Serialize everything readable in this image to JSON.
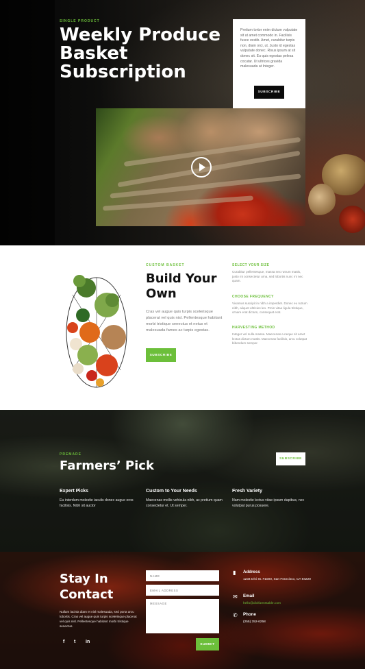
{
  "colors": {
    "accent": "#6cbf3a",
    "dark": "#0b0b0b",
    "white": "#ffffff"
  },
  "hero": {
    "eyebrow": "Single Product",
    "title": "Weekly Produce Basket Subscription",
    "card_text": "Pretium tortor enim dictum vulputate sit ut amet commodo in. Facilisis fusce vestib. Amet, curabitur turpis non, diam orci, ut. Justo id egestas vulputate donec. Risus ipsum at sit donec sit. Eu quis egestas pelesa cocutar. Ut ultrices gravida malesuada at Integer.",
    "subscribe_label": "Subscribe",
    "play_icon": "play-icon"
  },
  "build": {
    "eyebrow": "Custom Basket",
    "title": "Build Your Own",
    "text": "Cras vel augue quis turpis scelerisque placerat vel quis nisl. Pellentesque habitant morbi tristique senectus et netus et malesuada fames ac turpis egestas.",
    "subscribe_label": "Subscribe",
    "features": [
      {
        "title": "Select Your Size",
        "text": "Curabitur pellentesque, massa nec rutrum mattis, justo mi consectetur urna, sed lobortis nunc mi nec quam."
      },
      {
        "title": "Choose Frequency",
        "text": "Vivamus suscipit in nibh a imperdiet. Donec eu rutrum nibh, aliquet ultricies leo. Proin vitae ligula tristique, ornare erat dictum, consequat erat."
      },
      {
        "title": "Harvesting Method",
        "text": "Integer vel nulla massa. Maecenas a neque sit amet lectus dictum mattis. Maecenas facilisis, arcu volutpat bibendum semper."
      }
    ]
  },
  "farmers": {
    "eyebrow": "Premade",
    "title": "Farmers’ Pick",
    "subscribe_label": "Subscribe",
    "columns": [
      {
        "title": "Expert Picks",
        "text": "Eu interdum molestie iaculis donec augue eros facilisis. Nibh sit auctor"
      },
      {
        "title": "Custom to Your Needs",
        "text": "Maecenas mollis vehicula nibh, ac pretium quam consectetur et. Ut semper."
      },
      {
        "title": "Fresh Variety",
        "text": "Nam molestie lectus vitae ipsum dapibus, nec volutpat purus posuere."
      }
    ]
  },
  "contact": {
    "title": "Stay In Contact",
    "text": "Nullam lacinia diam et nisl malesuada, sed porta arcu lobortis. Cras vel augue quis turpis scelerisque placerat vel quis nisl. Pellentesque habitant morbi tristique senectus.",
    "social": [
      "f",
      "t",
      "in"
    ],
    "form": {
      "name_placeholder": "Name",
      "email_placeholder": "Email Address",
      "message_placeholder": "Message",
      "submit_label": "Submit"
    },
    "info": [
      {
        "icon": "map-icon",
        "title": "Address",
        "text": "1234 Divi St. #1000, San Francisco, CA 94220"
      },
      {
        "icon": "envelope-icon",
        "title": "Email",
        "text": "hello@divifarmstable.com"
      },
      {
        "icon": "phone-icon",
        "title": "Phone",
        "text": "(255) 352-6258"
      }
    ]
  }
}
